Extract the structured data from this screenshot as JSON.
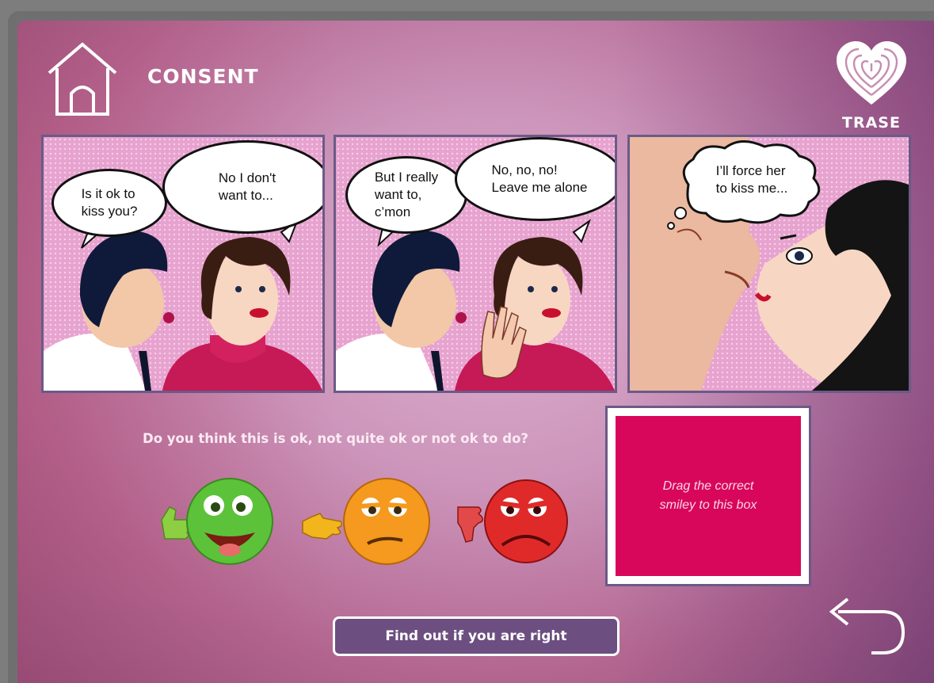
{
  "header": {
    "title": "CONSENT",
    "logo_text": "TRASE"
  },
  "panels": [
    {
      "bubbles": [
        "Is it ok to\nkiss you?",
        "No I don't\nwant to..."
      ]
    },
    {
      "bubbles": [
        "But I really\nwant to,\nc’mon",
        "No, no, no!\nLeave me alone"
      ]
    },
    {
      "bubbles": [
        "I’ll force her\nto kiss me..."
      ]
    }
  ],
  "question": "Do you think this is ok, not quite ok or not ok to do?",
  "smileys": [
    {
      "name": "ok",
      "color": "#5cc23a"
    },
    {
      "name": "not-quite-ok",
      "color": "#f59a1e"
    },
    {
      "name": "not-ok",
      "color": "#e02a2a"
    }
  ],
  "dropzone": {
    "text": "Drag the correct\nsmiley to this box",
    "color": "#d8075b"
  },
  "button": {
    "label": "Find out if you are right"
  },
  "icons": {
    "home": "home-icon",
    "back": "back-arrow-icon",
    "logo": "fingerprint-heart-icon"
  }
}
